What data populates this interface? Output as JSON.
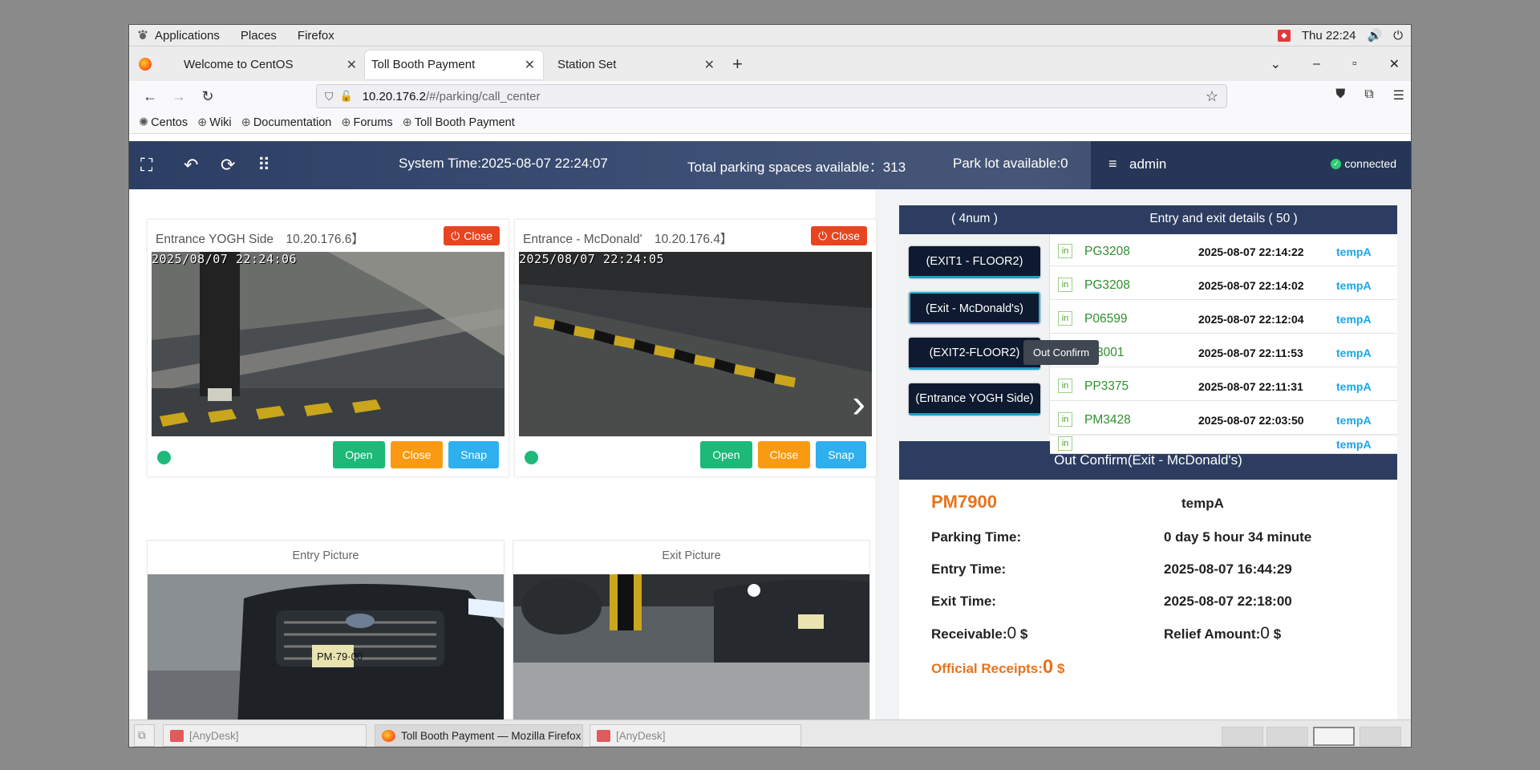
{
  "gnome": {
    "menus": [
      "Applications",
      "Places",
      "Firefox"
    ],
    "clock": "Thu 22:24"
  },
  "tabs": [
    {
      "title": "Welcome to CentOS"
    },
    {
      "title": "Toll Booth Payment"
    },
    {
      "title": "Station Set"
    }
  ],
  "nav": {
    "url_host": "10.20.176.2",
    "url_path": "/#/parking/call_center"
  },
  "bookmarks": [
    "Centos",
    "Wiki",
    "Documentation",
    "Forums",
    "Toll Booth Payment"
  ],
  "header": {
    "system_time": "System Time:2025-08-07 22:24:07",
    "total_spaces": "Total parking spaces available：313",
    "park_lot": "Park lot available:0",
    "user": "admin",
    "status": "connected"
  },
  "cameras": [
    {
      "title": "Entrance YOGH Side　10.20.176.6】",
      "close_label": "Close",
      "timestamp": "2025/08/07 22:24:06",
      "open": "Open",
      "close": "Close",
      "snap": "Snap"
    },
    {
      "title": "Entrance - McDonald'　10.20.176.4】",
      "close_label": "Close",
      "timestamp": "2025/08/07 22:24:05",
      "open": "Open",
      "close": "Close",
      "snap": "Snap"
    }
  ],
  "pictures": {
    "entry_title": "Entry Picture",
    "exit_title": "Exit Picture"
  },
  "channels": {
    "header": "( 4num )",
    "items": [
      "(EXIT1 - FLOOR2)",
      "(Exit - McDonald's)",
      "(EXIT2-FLOOR2)",
      "(Entrance YOGH Side)"
    ],
    "tooltip": "Out Confirm"
  },
  "details": {
    "header": "Entry and exit details ( 50 )",
    "rows": [
      {
        "dir": "in",
        "plate": "PG3208",
        "time": "2025-08-07 22:14:22",
        "user": "tempA"
      },
      {
        "dir": "in",
        "plate": "PG3208",
        "time": "2025-08-07 22:14:02",
        "user": "tempA"
      },
      {
        "dir": "in",
        "plate": "P06599",
        "time": "2025-08-07 22:12:04",
        "user": "tempA"
      },
      {
        "dir": "in",
        "plate": "3001",
        "time": "2025-08-07 22:11:53",
        "user": "tempA"
      },
      {
        "dir": "in",
        "plate": "PP3375",
        "time": "2025-08-07 22:11:31",
        "user": "tempA"
      },
      {
        "dir": "in",
        "plate": "PM3428",
        "time": "2025-08-07 22:03:50",
        "user": "tempA"
      },
      {
        "dir": "in",
        "plate": "",
        "time": "",
        "user": "tempA"
      }
    ]
  },
  "out_confirm": {
    "header": "Out Confirm(Exit - McDonald's)",
    "plate": "PM7900",
    "user": "tempA",
    "parking_time_label": "Parking Time:",
    "parking_time": "0 day 5 hour 34 minute",
    "entry_time_label": "Entry Time:",
    "entry_time": "2025-08-07 16:44:29",
    "exit_time_label": "Exit Time:",
    "exit_time": "2025-08-07 22:18:00",
    "receivable_label": "Receivable:",
    "receivable_value": "0",
    "currency": "$",
    "relief_label": "Relief Amount:",
    "relief_value": "0",
    "official_label": "Official Receipts:",
    "official_value": "0"
  },
  "taskbar": {
    "items": [
      "[AnyDesk]",
      "Toll Booth Payment — Mozilla Firefox",
      "[AnyDesk]"
    ]
  }
}
